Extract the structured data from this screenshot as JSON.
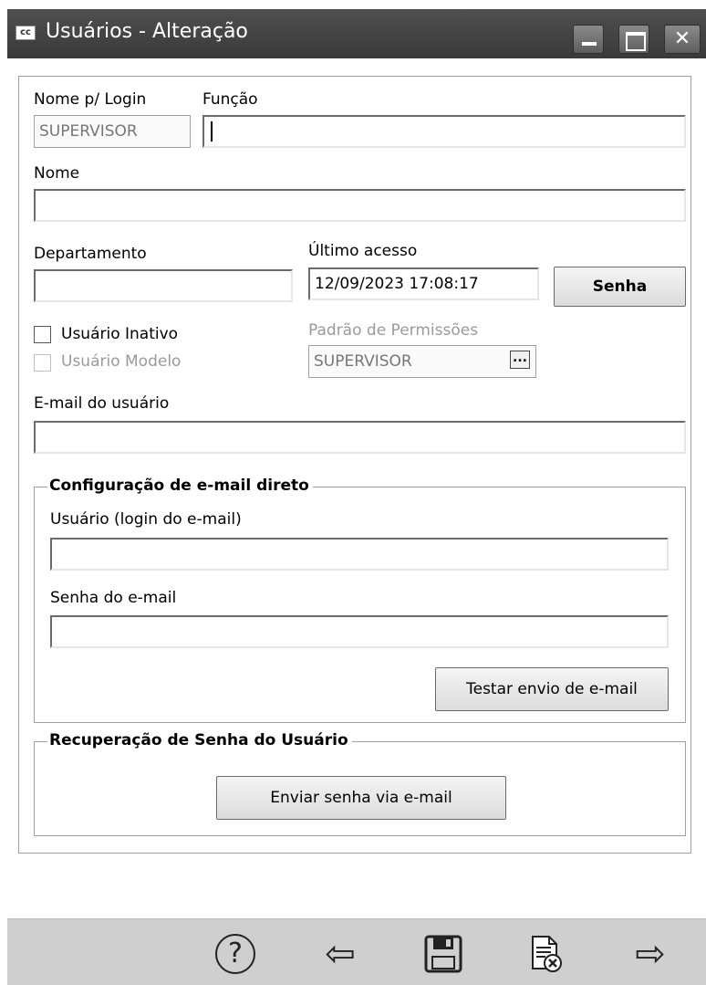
{
  "window": {
    "app_icon": "cc",
    "title": "Usuários - Alteração",
    "controls": [
      "minimize-icon",
      "maximize-icon",
      "close-icon"
    ]
  },
  "form": {
    "login_label": "Nome p/ Login",
    "login_value": "SUPERVISOR",
    "funcao_label": "Função",
    "funcao_value": "",
    "nome_label": "Nome",
    "nome_value": "",
    "departamento_label": "Departamento",
    "departamento_value": "",
    "ultimo_acesso_label": "Último acesso",
    "ultimo_acesso_value": "12/09/2023 17:08:17",
    "senha_button": "Senha",
    "inativo_label": "Usuário Inativo",
    "modelo_label": "Usuário Modelo",
    "padrao_label": "Padrão de Permissões",
    "padrao_value": "SUPERVISOR",
    "padrao_button": "...",
    "email_label": "E-mail do usuário",
    "email_value": ""
  },
  "email_config": {
    "title": "Configuração de e-mail direto",
    "user_label": "Usuário (login do e-mail)",
    "user_value": "",
    "password_label": "Senha do e-mail",
    "password_value": "",
    "test_button": "Testar envio de e-mail"
  },
  "recovery": {
    "title": "Recuperação de Senha do Usuário",
    "send_button": "Enviar senha via e-mail"
  },
  "footer": {
    "icons": [
      "help-icon",
      "back-arrow-icon",
      "save-icon",
      "cancel-document-icon",
      "forward-arrow-icon"
    ]
  }
}
